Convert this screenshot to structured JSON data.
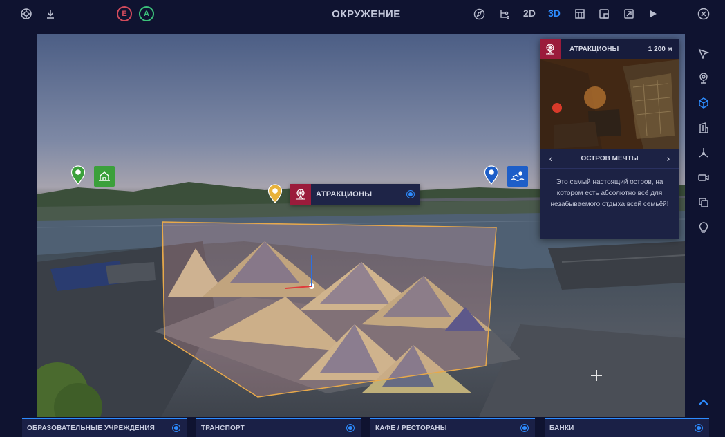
{
  "header": {
    "title": "ОКРУЖЕНИЕ",
    "badge_e": "E",
    "badge_a": "A",
    "view_2d": "2D",
    "view_3d": "3D",
    "active_view": "3D",
    "icons": [
      "settings-icon",
      "download-icon",
      "compass-icon",
      "hierarchy-icon",
      "map-grid-icon",
      "layout-icon",
      "fullscreen-icon",
      "play-icon",
      "close-icon"
    ]
  },
  "colors": {
    "accent": "#2d8cff",
    "attractions": "#9b1b3b",
    "badge_e": "#d34b5c",
    "badge_a": "#3cc27a",
    "education": "#3ba03b",
    "sport": "#1d5ec8",
    "selected_pin": "#e8b23a"
  },
  "scene": {
    "selected_label": "АТРАКЦИОНЫ"
  },
  "info_panel": {
    "category": "АТРАКЦИОНЫ",
    "distance": "1 200 м",
    "place": "ОСТРОВ МЕЧТЫ",
    "description": "Это самый настоящий остров, на котором есть абсолютно всё для незабываемого отдыха всей семьёй!"
  },
  "right_toolbar": [
    "pointer-icon",
    "location-icon",
    "cube-icon",
    "building-icon",
    "axes-icon",
    "camera-icon",
    "copy-icon",
    "lightbulb-icon",
    "chevron-up-icon"
  ],
  "categories": [
    {
      "label": "ОБРАЗОВАТЕЛЬНЫЕ УЧРЕЖДЕНИЯ"
    },
    {
      "label": "ТРАНСПОРТ"
    },
    {
      "label": "КАФЕ / РЕСТОРАНЫ"
    },
    {
      "label": "БАНКИ"
    }
  ]
}
